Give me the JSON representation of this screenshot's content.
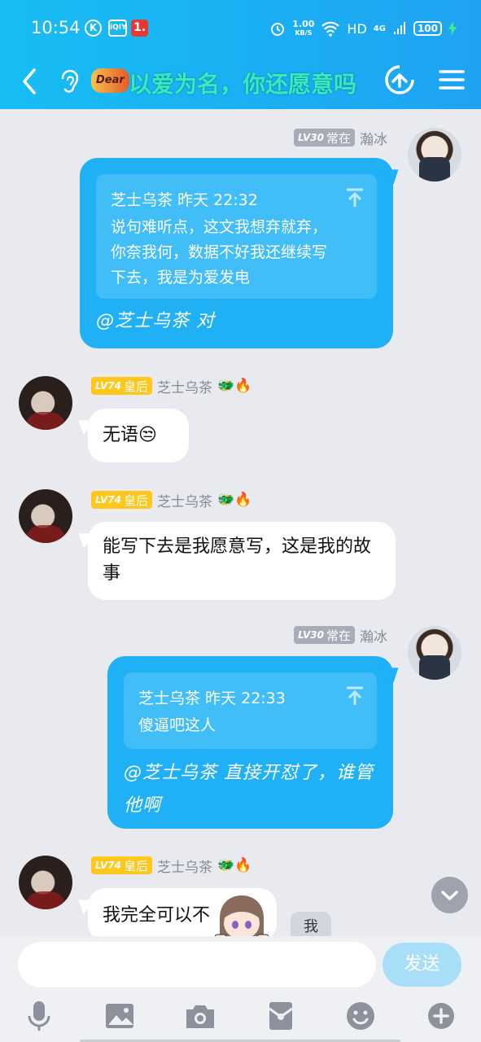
{
  "status_bar": {
    "time": "10:54",
    "app_icon_k": "K",
    "app_icon_iqiyi": "iQIY",
    "app_icon_one": "1.",
    "net_speed_value": "1.00",
    "net_speed_unit": "KB/S",
    "hd": "HD",
    "signal": "4G",
    "battery": "100"
  },
  "header": {
    "logo_text": "Dear",
    "title": "以爱为名，你还愿意吗"
  },
  "messages": [
    {
      "sender_level": "LV30",
      "sender_title": "常在",
      "sender_name": "瀚冰",
      "quote_author": "芝士乌茶",
      "quote_time": "昨天 22:32",
      "quote_text": "说句难听点，这文我想弃就弃，你奈我何，数据不好我还继续写下去，我是为爱发电",
      "reply_text": "@芝士乌茶 对"
    },
    {
      "sender_level": "LV74",
      "sender_title": "皇后",
      "sender_name": "芝士乌茶",
      "text": "无语😒"
    },
    {
      "sender_level": "LV74",
      "sender_title": "皇后",
      "sender_name": "芝士乌茶",
      "text": "能写下去是我愿意写，这是我的故事"
    },
    {
      "sender_level": "LV30",
      "sender_title": "常在",
      "sender_name": "瀚冰",
      "quote_author": "芝士乌茶",
      "quote_time": "昨天 22:33",
      "quote_text": "傻逼吧这人",
      "reply_text": "@芝士乌茶 直接开怼了，谁管他啊"
    },
    {
      "sender_level": "LV74",
      "sender_title": "皇后",
      "sender_name": "芝士乌茶",
      "text": "我完全可以不"
    }
  ],
  "deco_icons": "🐲🔥",
  "me_chip": "我",
  "input": {
    "value": "",
    "send_label": "发送"
  },
  "toolbar_icons": [
    "microphone-icon",
    "image-icon",
    "camera-icon",
    "red-packet-icon",
    "emoji-icon",
    "plus-icon"
  ],
  "colors": {
    "header": "#1ea3f2",
    "my_bubble": "#1fb0f5",
    "level_gold": "#ffc71a",
    "level_grey": "#a7acb8"
  }
}
